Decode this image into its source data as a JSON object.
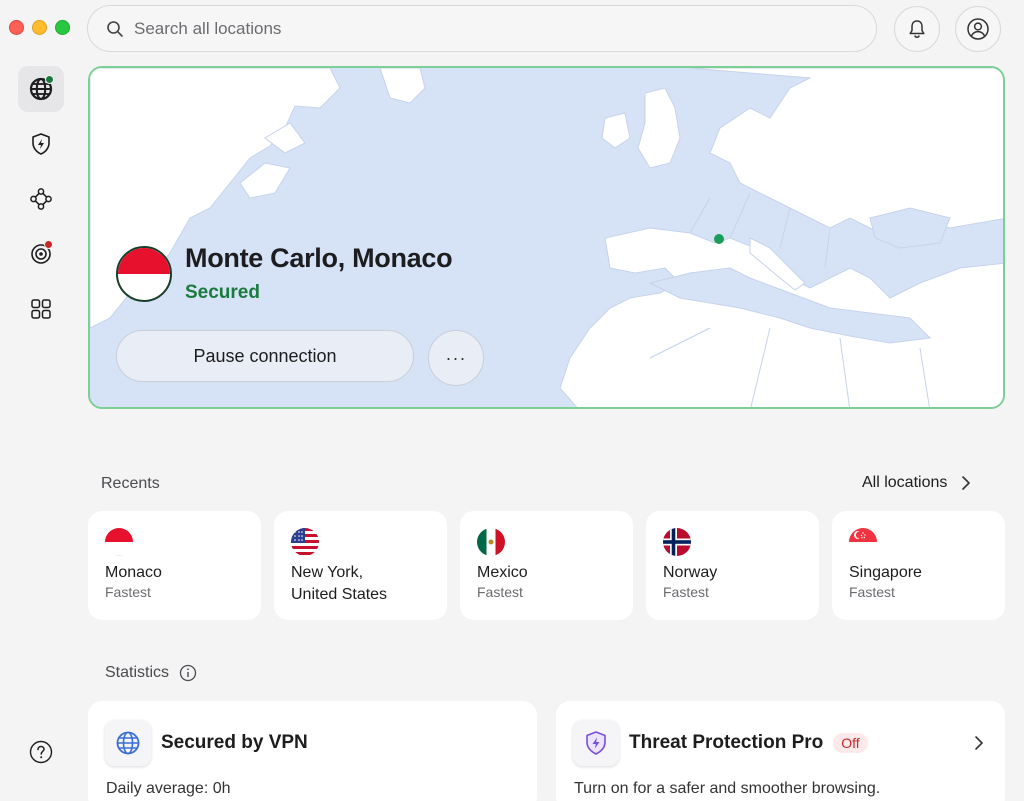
{
  "window": {
    "controls": [
      "close",
      "minimize",
      "zoom"
    ]
  },
  "search": {
    "placeholder": "Search all locations",
    "icon": "search-icon"
  },
  "header": {
    "icons": [
      "bell-icon",
      "account-icon"
    ]
  },
  "sidebar": {
    "items": [
      {
        "name": "globe-icon",
        "active": true,
        "badge_color": "#1b7a3e"
      },
      {
        "name": "shield-bolt-icon",
        "active": false
      },
      {
        "name": "meshnet-icon",
        "active": false
      },
      {
        "name": "dark-web-monitor-icon",
        "active": false,
        "badge_color": "#c62828"
      },
      {
        "name": "grid-icon",
        "active": false
      }
    ],
    "help": "help-icon"
  },
  "hero": {
    "location": "Monte Carlo, Monaco",
    "status": "Secured",
    "pause_label": "Pause connection",
    "more_label": "···",
    "border_color": "#7ccf95",
    "status_color": "#1b7a3e"
  },
  "recents": {
    "label": "Recents",
    "all_label": "All locations",
    "items": [
      {
        "name": "Monaco",
        "sub": "Fastest",
        "flag": "monaco-flag"
      },
      {
        "name": "New York, United States",
        "name_line1": "New York,",
        "name_line2": "United States",
        "sub": "",
        "flag": "us-flag"
      },
      {
        "name": "Mexico",
        "sub": "Fastest",
        "flag": "mexico-flag"
      },
      {
        "name": "Norway",
        "sub": "Fastest",
        "flag": "norway-flag"
      },
      {
        "name": "Singapore",
        "sub": "Fastest",
        "flag": "singapore-flag"
      }
    ]
  },
  "statistics": {
    "label": "Statistics",
    "cards": [
      {
        "title": "Secured by VPN",
        "sub": "Daily average: 0h",
        "icon": "globe-icon"
      },
      {
        "title": "Threat Protection Pro",
        "badge": "Off",
        "sub": "Turn on for a safer and smoother browsing.",
        "icon": "shield-bolt-icon"
      }
    ]
  }
}
